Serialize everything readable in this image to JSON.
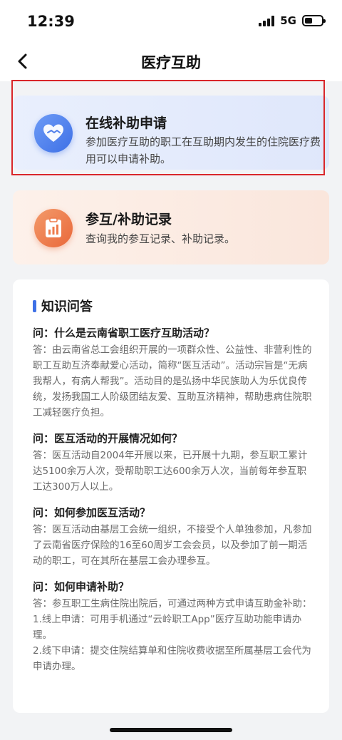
{
  "status_bar": {
    "time": "12:39",
    "network": "5G"
  },
  "nav": {
    "title": "医疗互助"
  },
  "cards": {
    "apply": {
      "title": "在线补助申请",
      "description": "参加医疗互助的职工在互助期内发生的住院医疗费用可以申请补助。",
      "icon": "heart-hands-icon",
      "accent_color": "#3e70e6"
    },
    "record": {
      "title": "参互/补助记录",
      "description": "查询我的参互记录、补助记录。",
      "icon": "records-icon",
      "accent_color": "#e9683a"
    }
  },
  "faq": {
    "title": "知识问答",
    "items": [
      {
        "question": "问：什么是云南省职工医疗互助活动？",
        "answer": "答：由云南省总工会组织开展的一项群众性、公益性、非营利性的职工互助互济奉献爱心活动，简称“医互活动”。活动宗旨是“无病我帮人，有病人帮我”。活动目的是弘扬中华民族助人为乐优良传统，发扬我国工人阶级团结友爱、互助互济精神，帮助患病住院职工减轻医疗负担。"
      },
      {
        "question": "问：医互活动的开展情况如何？",
        "answer": "答：医互活动自2004年开展以来，已开展十九期，参互职工累计达5100余万人次，受帮助职工达600余万人次，当前每年参互职工达300万人以上。"
      },
      {
        "question": "问：如何参加医互活动？",
        "answer": "答：医互活动由基层工会统一组织，不接受个人单独参加，凡参加了云南省医疗保险的16至60周岁工会会员，以及参加了前一期活动的职工，可在其所在基层工会办理参互。"
      },
      {
        "question": "问：如何申请补助？",
        "answer_lines": [
          "答：参互职工生病住院出院后，可通过两种方式申请互助金补助：",
          "1.线上申请：可用手机通过“云岭职工App”医疗互助功能申请办理。",
          "2.线下申请：提交住院结算单和住院收费收据至所属基层工会代为申请办理。"
        ]
      }
    ]
  }
}
